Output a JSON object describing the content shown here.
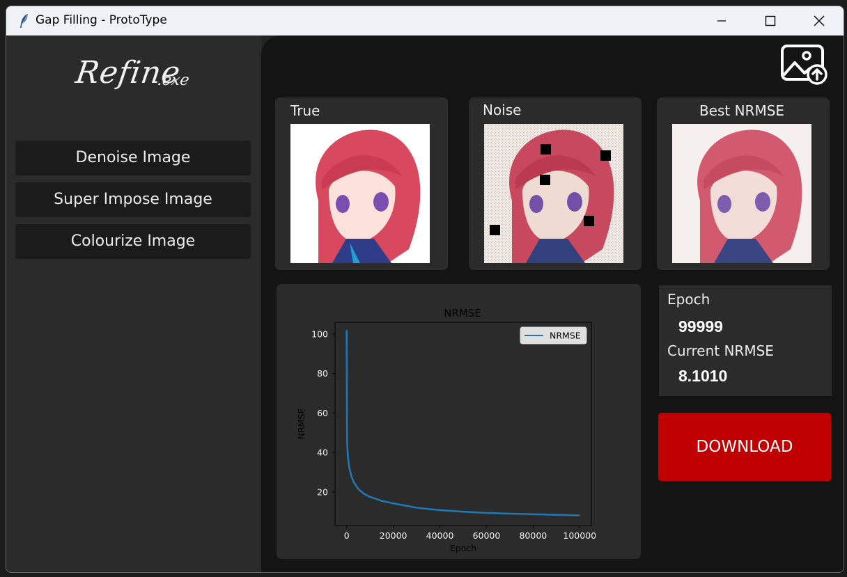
{
  "window": {
    "title": "Gap Filling - ProtoType"
  },
  "sidebar": {
    "logo_main": "Refine",
    "logo_ext": ".exe",
    "buttons": [
      "Denoise Image",
      "Super Impose Image",
      "Colourize Image"
    ]
  },
  "cards": {
    "true_label": "True",
    "noise_label": "Noise",
    "best_label": "Best NRMSE"
  },
  "stats": {
    "epoch_label": "Epoch",
    "epoch_value": "99999",
    "nrmse_label": "Current NRMSE",
    "nrmse_value": "8.1010"
  },
  "download_label": "DOWNLOAD",
  "colors": {
    "accent": "#c00000",
    "line": "#1f77b4"
  },
  "chart_data": {
    "type": "line",
    "title": "NRMSE",
    "xlabel": "Epoch",
    "ylabel": "NRMSE",
    "xlim": [
      -5000,
      105000
    ],
    "ylim": [
      3,
      106
    ],
    "xticks": [
      0,
      20000,
      40000,
      60000,
      80000,
      100000
    ],
    "yticks": [
      20,
      40,
      60,
      80,
      100
    ],
    "legend": "top-right",
    "grid": false,
    "series": [
      {
        "name": "NRMSE",
        "x": [
          0,
          100,
          200,
          500,
          1000,
          2000,
          3000,
          5000,
          7500,
          10000,
          15000,
          20000,
          30000,
          40000,
          50000,
          60000,
          70000,
          80000,
          90000,
          99999
        ],
        "y": [
          102,
          60,
          45,
          38,
          33,
          28,
          25,
          21.5,
          19,
          17.5,
          15.5,
          14.2,
          12,
          10.8,
          10,
          9.4,
          9,
          8.7,
          8.4,
          8.1
        ]
      }
    ]
  }
}
